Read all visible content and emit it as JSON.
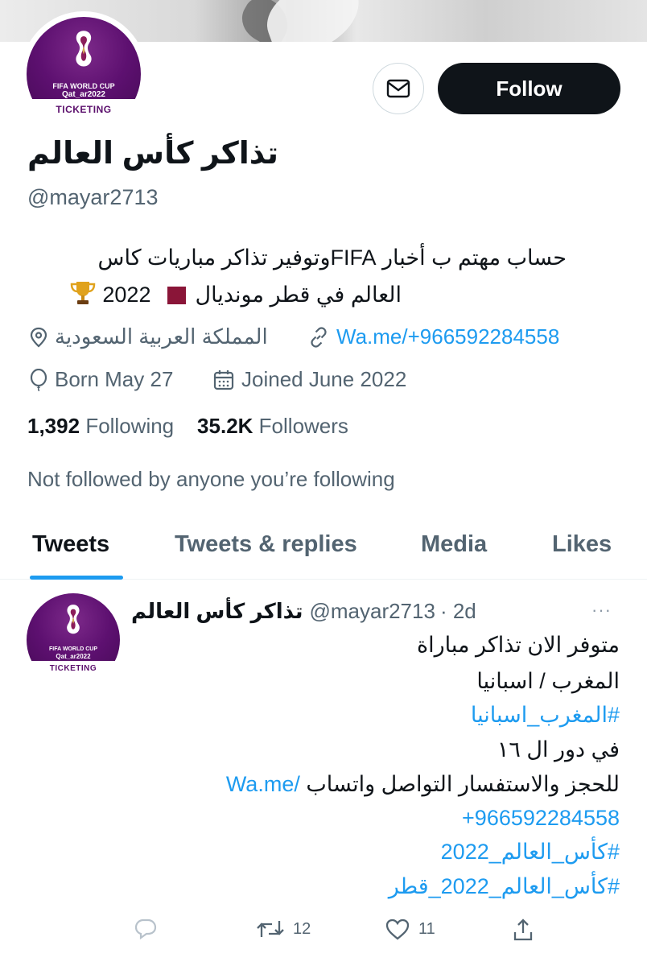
{
  "profile": {
    "display_name": "تذاكر كأس العالم",
    "handle": "@mayar2713",
    "bio_line1": "حساب مهتم ب أخبار FIFAوتوفير تذاكر مباريات كاس",
    "bio_line2": "العالم في قطر مونديال",
    "bio_year": "2022",
    "location": "المملكة العربية السعودية",
    "website": "Wa.me/+966592284558",
    "birthday": "Born May 27",
    "joined": "Joined June 2022",
    "following_count": "1,392",
    "following_label": "Following",
    "followers_count": "35.2K",
    "followers_label": "Followers",
    "not_followed": "Not followed by anyone you’re following",
    "avatar_line1": "FIFA WORLD CUP",
    "avatar_line2": "Qat_ar2022",
    "avatar_line3": "TICKETING"
  },
  "actions": {
    "follow_label": "Follow"
  },
  "tabs": [
    {
      "label": "Tweets"
    },
    {
      "label": "Tweets & replies"
    },
    {
      "label": "Media"
    },
    {
      "label": "Likes"
    }
  ],
  "tweet": {
    "author_name": "تذاكر كأس العالم",
    "author_handle": "@mayar2713",
    "time": "· 2d",
    "more": "···",
    "line1": "متوفر الان تذاكر مباراة",
    "line2": "المغرب / اسبانيا",
    "line3": "#المغرب_اسبانيا",
    "line4": "في دور ال ١٦",
    "line5_text": "للحجز والاستفسار التواصل واتساب",
    "line5_link": "Wa.me/",
    "line6": "+966592284558",
    "line7": "#كأس_العالم_2022",
    "line8": "#كأس_العالم_2022_قطر",
    "retweets": "12",
    "likes": "11"
  },
  "colors": {
    "accent": "#1d9bf0",
    "text": "#0f1419",
    "secondary": "#536471",
    "brand_purple": "#5b0f6c"
  }
}
